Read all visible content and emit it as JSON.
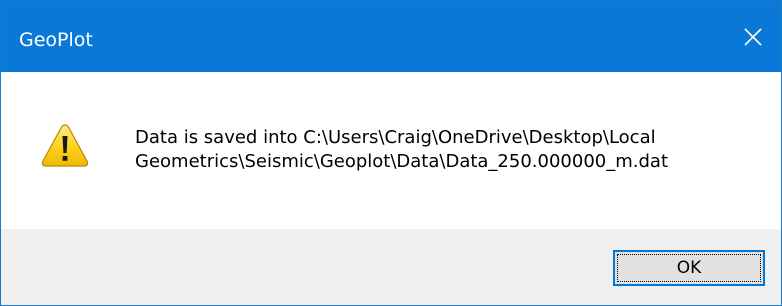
{
  "window": {
    "title": "GeoPlot",
    "close_icon": "close-icon",
    "titlebar_color": "#0a78d7"
  },
  "message": {
    "icon": "warning-icon",
    "line1": "Data is saved into C:\\Users\\Craig\\OneDrive\\Desktop\\Local",
    "line2": "Geometrics\\Seismic\\Geoplot\\Data\\Data_250.000000_m.dat"
  },
  "buttons": {
    "ok_label": "OK"
  }
}
